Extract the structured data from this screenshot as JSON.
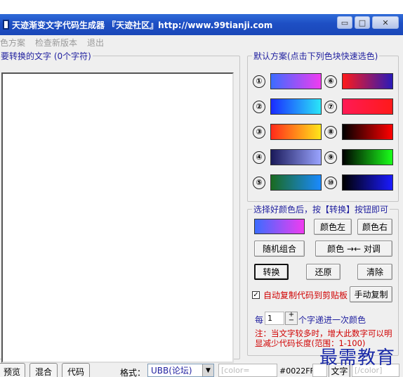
{
  "window": {
    "title": "天迹渐变文字代码生成器 『天迹社区』http://www.99tianji.com",
    "min": "▭",
    "max": "□",
    "close": "✕"
  },
  "menu": [
    "色方案",
    "检查新版本",
    "退出"
  ],
  "left": {
    "label": "要转换的文字 (0个字符)"
  },
  "scheme": {
    "label": "默认方案(点击下列色块快速选色)",
    "items": [
      {
        "num": "①",
        "colors": [
          "#3b6cff",
          "#f03cf0"
        ]
      },
      {
        "num": "⑥",
        "colors": [
          "#ff1a1a",
          "#2a1ab8"
        ]
      },
      {
        "num": "②",
        "colors": [
          "#1a2cff",
          "#2ae6f7"
        ]
      },
      {
        "num": "⑦",
        "colors": [
          "#ff1a55",
          "#ff1a1a"
        ]
      },
      {
        "num": "③",
        "colors": [
          "#ff2a1a",
          "#ffe61a"
        ]
      },
      {
        "num": "⑧",
        "colors": [
          "#000000",
          "#ff0000"
        ]
      },
      {
        "num": "④",
        "colors": [
          "#1a1a5a",
          "#9aa4ff"
        ]
      },
      {
        "num": "⑨",
        "colors": [
          "#000000",
          "#1aff1a"
        ]
      },
      {
        "num": "⑤",
        "colors": [
          "#1a6a20",
          "#1a8aff"
        ]
      },
      {
        "num": "⑩",
        "colors": [
          "#000000",
          "#1a1aff"
        ]
      }
    ]
  },
  "choose": {
    "label": "选择好颜色后，按【转换】按钮即可",
    "preview": [
      "#3b6cff",
      "#f03cf0"
    ],
    "left_btn": "颜色左",
    "right_btn": "颜色右",
    "random_btn": "随机组合",
    "swap_btn": "颜色 →← 对调",
    "convert_btn": "转换",
    "restore_btn": "还原",
    "clear_btn": "清除",
    "auto_copy": "自动复制代码到剪贴板",
    "manual_copy": "手动复制",
    "every_prefix": "每",
    "every_value": "1",
    "every_suffix": "个字递进一次颜色",
    "note": "注：当文字较多时，增大此数字可以明显减少代码长度(范围：1-100)"
  },
  "bottom": {
    "tabs": [
      "预览",
      "混合",
      "代码"
    ],
    "format_label": "格式：",
    "format_value": "UBB(论坛)",
    "open_tag": "[color=",
    "color_value": "#0022FF",
    "text_btn": "文字",
    "close_tag": "[/color]"
  },
  "watermark": "最需教育"
}
